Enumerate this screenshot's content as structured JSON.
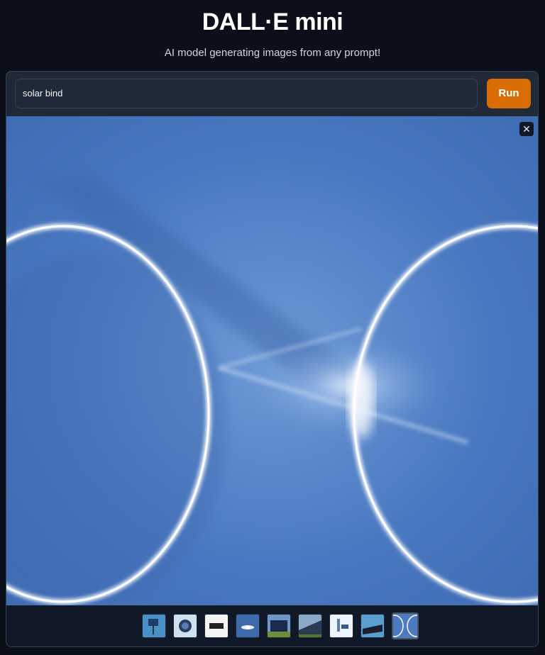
{
  "header": {
    "title": "DALL·E mini",
    "subtitle": "AI model generating images from any prompt!"
  },
  "prompt": {
    "value": "solar bind",
    "run_label": "Run"
  },
  "gallery": {
    "close_icon": "close-icon",
    "selected_index": 8,
    "thumbnail_count": 9
  },
  "colors": {
    "accent": "#d86d05",
    "background": "#0b0f19",
    "panel": "#1f2937"
  }
}
